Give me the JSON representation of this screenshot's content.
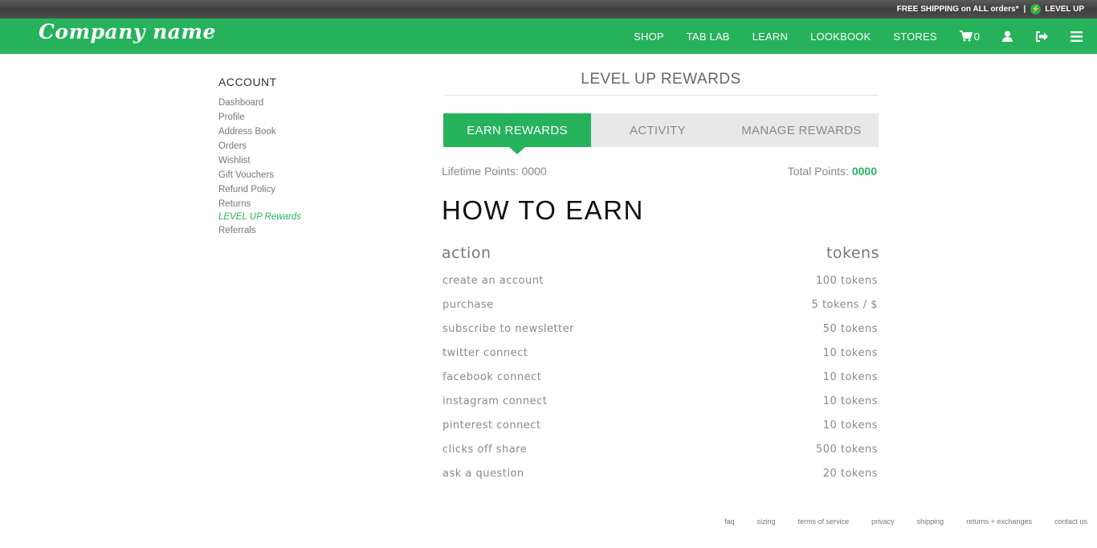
{
  "topbar": {
    "promo": "FREE SHIPPING on ALL orders*",
    "separator": "|",
    "levelup": "LEVEL UP"
  },
  "brand": {
    "logo": "Company name"
  },
  "nav": {
    "links": [
      "SHOP",
      "TAB LAB",
      "LEARN",
      "LOOKBOOK",
      "STORES"
    ],
    "cart_count": "0",
    "icons": [
      "cart-icon",
      "user-icon",
      "logout-icon",
      "menu-icon"
    ]
  },
  "sidebar": {
    "heading": "ACCOUNT",
    "items": [
      {
        "label": "Dashboard"
      },
      {
        "label": "Profile"
      },
      {
        "label": "Address Book"
      },
      {
        "label": "Orders"
      },
      {
        "label": "Wishlist"
      },
      {
        "label": "Gift Vouchers"
      },
      {
        "label": "Refund Policy"
      },
      {
        "label": "Returns"
      },
      {
        "label": "LEVEL UP Rewards",
        "active": true
      },
      {
        "label": "Referrals"
      }
    ]
  },
  "main": {
    "title": "LEVEL UP REWARDS",
    "tabs": [
      {
        "label": "EARN REWARDS",
        "active": true
      },
      {
        "label": "ACTIVITY"
      },
      {
        "label": "MANAGE REWARDS"
      }
    ],
    "lifetime_points": "Lifetime Points: 0000",
    "total_points_label": "Total Points: ",
    "total_points_value": "0000",
    "section_title": "HOW TO EARN",
    "table": {
      "headers": [
        "action",
        "tokens"
      ],
      "rows": [
        [
          "create an account",
          "100 tokens"
        ],
        [
          "purchase",
          "5 tokens / $"
        ],
        [
          "subscribe to newsletter",
          "50 tokens"
        ],
        [
          "twitter connect",
          "10 tokens"
        ],
        [
          "facebook connect",
          "10 tokens"
        ],
        [
          "instagram connect",
          "10 tokens"
        ],
        [
          "pinterest connect",
          "10 tokens"
        ],
        [
          "clicks off share",
          "500 tokens"
        ],
        [
          "ask a question",
          "20 tokens"
        ]
      ]
    }
  },
  "footer": {
    "links": [
      "faq",
      "sizing",
      "terms of service",
      "privacy",
      "shipping",
      "returns + exchanges",
      "contact us"
    ]
  },
  "colors": {
    "brand_green": "#25b25b",
    "top_strip": "#4a4a4a"
  }
}
